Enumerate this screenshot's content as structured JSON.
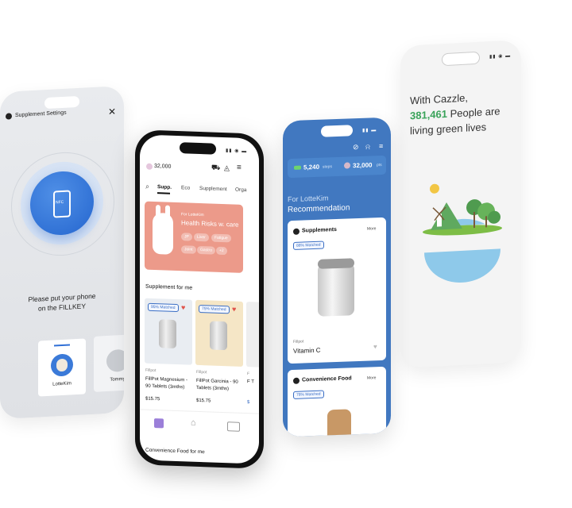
{
  "phone1": {
    "title": "Supplement Settings",
    "nfc_label": "NFC",
    "message_line1": "Please put your phone",
    "message_line2": "on the FILLKEY",
    "profiles": [
      "LotteKim",
      "Tommy"
    ]
  },
  "phone2": {
    "points": "32,000",
    "tabs": [
      "Supp.",
      "Eco",
      "Supplement",
      "Orga"
    ],
    "banner_small": "For LotteKim",
    "banner_title": "Health Risks w. care",
    "banner_tags": [
      "JP",
      "Liver",
      "Fatigue",
      "Joint",
      "Gastro",
      "+2"
    ],
    "section_title": "Supplement for me",
    "products": [
      {
        "match": "95% Matched",
        "brand": "Fillpot",
        "name": "FillPot Magnesium - 90 Tablets (3mths)",
        "price": "$15.75"
      },
      {
        "match": "75% Matched",
        "brand": "Fillpot",
        "name": "FillPot Garcinia - 90 Tablets (3mths)",
        "price": "$15.75"
      },
      {
        "brand": "F",
        "name": "F T",
        "price": "$"
      }
    ],
    "bottom_section": "Convenience Food for me"
  },
  "phone3": {
    "steps_value": "5,240",
    "steps_unit": "steps",
    "points_value": "32,000",
    "points_unit": "pts",
    "greeting": "For LotteKim",
    "recommendation": "Recommendation",
    "card1_title": "Supplements",
    "card1_more": "More",
    "card1_match": "88% Matched",
    "card1_brand": "Fillpot",
    "card1_name": "Vitamin C",
    "card2_title": "Convenience Food",
    "card2_more": "More",
    "card2_match": "78% Matched"
  },
  "phone4": {
    "line1": "With Cazzle,",
    "count": "381,461",
    "line2_suffix": "People are",
    "line3": "living green lives",
    "count_color": "#3aa35a"
  },
  "icons": [
    "nfc-phone-icon",
    "close-icon",
    "cart-icon",
    "bell-icon",
    "menu-icon",
    "search-icon",
    "heart-icon",
    "home-icon",
    "link-icon",
    "coin-icon",
    "steps-icon"
  ]
}
